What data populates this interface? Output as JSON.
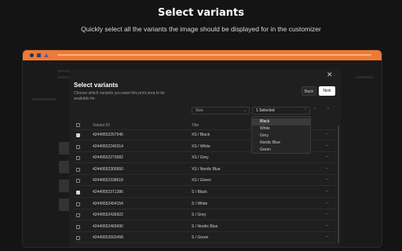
{
  "hero": {
    "title": "Select variants",
    "subtitle": "Quickly select all the variants the image should be displayed for in the customizer"
  },
  "browser": {
    "accent": "#ee7a34",
    "controls": [
      "circle-icon",
      "square-icon",
      "triangle-icon"
    ]
  },
  "modal": {
    "title": "Select variants",
    "description": "Choose which variants you want this print area to be available for.",
    "back_label": "Back",
    "next_label": "Next",
    "close_icon": "close-icon",
    "size_select": "Size",
    "variant_select": "1 Selected",
    "pager_prev": "‹",
    "pager_next": "›",
    "dropdown_options": [
      "Black",
      "White",
      "Grey",
      "Nordic Blue",
      "Green"
    ],
    "dropdown_active": "Black",
    "columns": {
      "id": "Variant ID",
      "title": "Title"
    },
    "rows": [
      {
        "id": "42449552207546",
        "title": "XS / Black",
        "checked": true
      },
      {
        "id": "42449552240314",
        "title": "XS / White",
        "checked": false
      },
      {
        "id": "42449552273082",
        "title": "XS / Grey",
        "checked": false
      },
      {
        "id": "42449552305850",
        "title": "XS / Nordic Blue",
        "checked": false
      },
      {
        "id": "42449552338618",
        "title": "XS / Green",
        "checked": false
      },
      {
        "id": "42449552371386",
        "title": "S / Black",
        "checked": true
      },
      {
        "id": "42449552404154",
        "title": "S / White",
        "checked": false
      },
      {
        "id": "42449552436922",
        "title": "S / Grey",
        "checked": false
      },
      {
        "id": "42449552469690",
        "title": "S / Nordic Blue",
        "checked": false
      },
      {
        "id": "42449552502458",
        "title": "S / Green",
        "checked": false
      }
    ],
    "row_menu": "···"
  }
}
